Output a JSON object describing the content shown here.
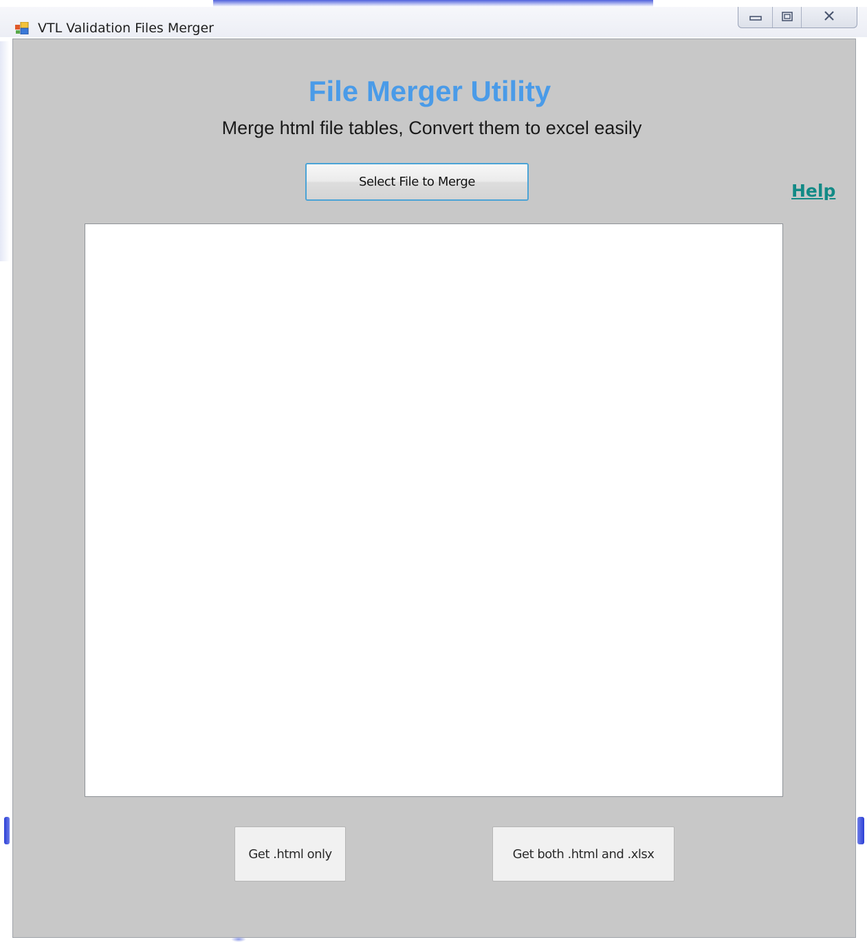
{
  "window": {
    "title": "VTL Validation Files Merger",
    "controls": {
      "minimize": "▭",
      "maximize": "▣",
      "close": "X"
    }
  },
  "main": {
    "heading": "File Merger Utility",
    "subheading": "Merge html file tables, Convert them to excel easily",
    "select_button_label": "Select File to Merge",
    "help_link_label": "Help",
    "html_only_button_label": "Get .html only",
    "both_button_label": "Get both .html and .xlsx"
  },
  "colors": {
    "heading": "#4a9be8",
    "help_link": "#128a86",
    "client_background": "#c8c8c8",
    "select_button_border": "#4aa3d6"
  },
  "icons": {
    "app": "app-icon",
    "minimize": "minimize-icon",
    "maximize": "maximize-icon",
    "close": "close-icon"
  }
}
